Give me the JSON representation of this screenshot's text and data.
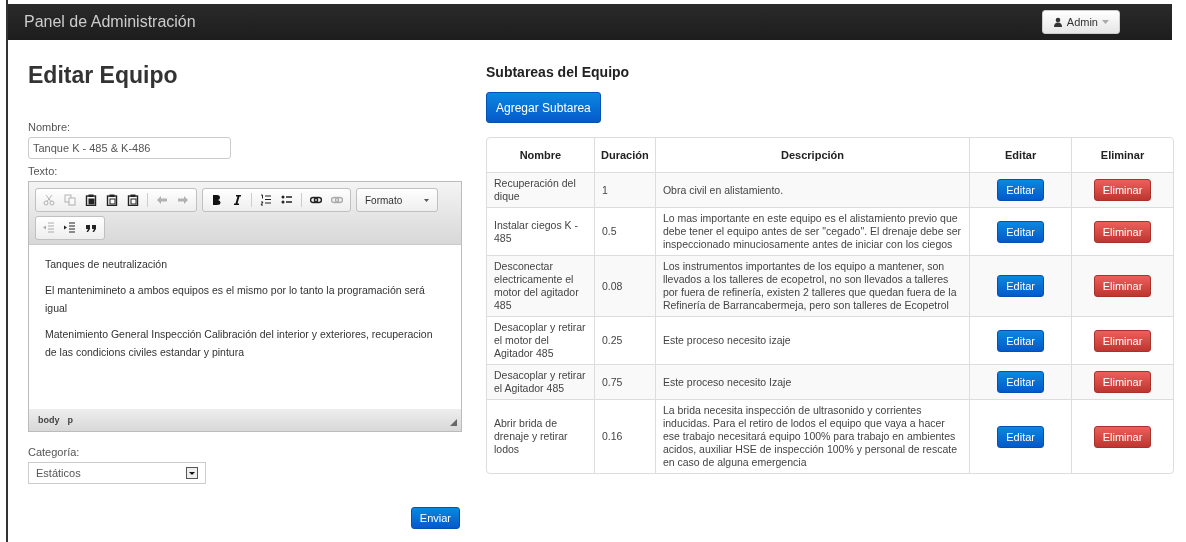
{
  "navbar": {
    "brand": "Panel de Administración",
    "user_menu": {
      "label": "Admin"
    }
  },
  "form": {
    "title": "Editar Equipo",
    "name_field": {
      "label": "Nombre:",
      "value": "Tanque K - 485 & K-486"
    },
    "text_label": "Texto:",
    "editor": {
      "toolbar": [
        [
          {
            "kind": "cut",
            "disabled": true
          },
          {
            "kind": "copy",
            "disabled": true
          },
          {
            "kind": "paste",
            "disabled": false
          },
          {
            "kind": "paste-text",
            "disabled": false
          },
          {
            "kind": "paste-word",
            "disabled": false
          },
          {
            "kind": "sep"
          },
          {
            "kind": "undo",
            "disabled": true
          },
          {
            "kind": "redo",
            "disabled": true
          }
        ],
        [
          {
            "kind": "bold",
            "disabled": false
          },
          {
            "kind": "italic",
            "disabled": false
          },
          {
            "kind": "sep"
          },
          {
            "kind": "ordered-list",
            "disabled": false
          },
          {
            "kind": "bullet-list",
            "disabled": false
          },
          {
            "kind": "sep"
          },
          {
            "kind": "link",
            "disabled": false
          },
          {
            "kind": "unlink",
            "disabled": true
          }
        ],
        [
          {
            "kind": "dropdown",
            "label": "Formato"
          }
        ],
        [
          {
            "kind": "outdent",
            "disabled": true
          },
          {
            "kind": "indent",
            "disabled": false
          },
          {
            "kind": "quote",
            "disabled": false
          }
        ]
      ],
      "paragraphs": [
        "Tanques de neutralización",
        "El mantenimineto a ambos equipos es el mismo por lo tanto la programación será igual",
        "Matenimiento General Inspección Calibración del interior y exteriores, recuperacion de las condicions civiles estandar y pintura"
      ],
      "path": [
        "body",
        "p"
      ]
    },
    "category": {
      "label": "Categoría:",
      "value": "Estáticos"
    },
    "submit": "Enviar"
  },
  "subtasks": {
    "title": "Subtareas del Equipo",
    "add_button": "Agregar Subtarea",
    "columns": [
      "Nombre",
      "Duración",
      "Descripción",
      "Editar",
      "Eliminar"
    ],
    "rows": [
      {
        "name": "Recuperación del dique",
        "duration": "1",
        "description": "Obra civil en alistamiento.",
        "edit": "Editar",
        "delete": "Eliminar"
      },
      {
        "name": "Instalar ciegos K - 485",
        "duration": "0.5",
        "description": "Lo mas importante en este equipo es el alistamiento previo que debe tener el equipo antes de ser \"cegado\". El drenaje debe ser inspeccionado minuciosamente antes de iniciar con los ciegos",
        "edit": "Editar",
        "delete": "Eliminar"
      },
      {
        "name": "Desconectar electricamente el motor del agitador 485",
        "duration": "0.08",
        "description": "Los instrumentos importantes de los equipo a mantener, son llevados a los talleres de ecopetrol, no son llevados a talleres por fuera de refinería, existen 2 talleres que quedan fuera de la Refinería de Barrancabermeja, pero son talleres de Ecopetrol",
        "edit": "Editar",
        "delete": "Eliminar"
      },
      {
        "name": "Desacoplar y retirar el motor del Agitador 485",
        "duration": "0.25",
        "description": "Este proceso necesito izaje",
        "edit": "Editar",
        "delete": "Eliminar"
      },
      {
        "name": "Desacoplar y retirar el Agitador 485",
        "duration": "0.75",
        "description": "Este proceso necesito Izaje",
        "edit": "Editar",
        "delete": "Eliminar"
      },
      {
        "name": "Abrir brida de drenaje y retirar lodos",
        "duration": "0.16",
        "description": "La brida necesita inspección de ultrasonido y corrientes inducidas. Para el retiro de lodos el equipo que vaya a hacer ese trabajo necesitará equipo 100% para trabajo en ambientes acidos, auxiliar HSE de inspección 100% y personal de rescate en caso de alguna emergencia",
        "edit": "Editar",
        "delete": "Eliminar"
      }
    ]
  }
}
